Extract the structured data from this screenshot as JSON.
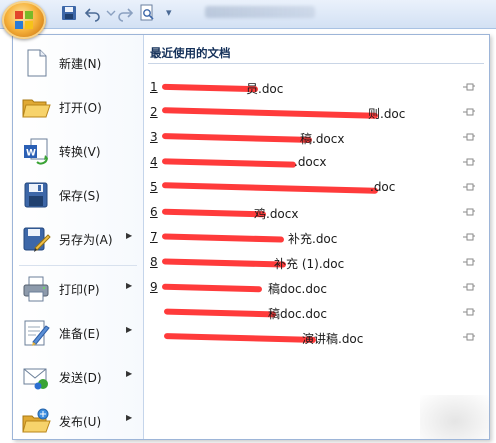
{
  "menu": {
    "items": [
      {
        "label": "新建(N)",
        "icon": "new-document-icon",
        "submenu": false
      },
      {
        "label": "打开(O)",
        "icon": "open-folder-icon",
        "submenu": false
      },
      {
        "label": "转换(V)",
        "icon": "convert-icon",
        "submenu": false
      },
      {
        "label": "保存(S)",
        "icon": "save-icon",
        "submenu": false
      },
      {
        "label": "另存为(A)",
        "icon": "save-as-icon",
        "submenu": true
      },
      {
        "label": "打印(P)",
        "icon": "print-icon",
        "submenu": true
      },
      {
        "label": "准备(E)",
        "icon": "prepare-icon",
        "submenu": true
      },
      {
        "label": "发送(D)",
        "icon": "send-icon",
        "submenu": true
      },
      {
        "label": "发布(U)",
        "icon": "publish-icon",
        "submenu": true
      }
    ]
  },
  "recent": {
    "header": "最近使用的文档",
    "documents": [
      {
        "num": "1",
        "visible_text": "员.doc"
      },
      {
        "num": "2",
        "visible_text": "则.doc"
      },
      {
        "num": "3",
        "visible_text": "稿.docx"
      },
      {
        "num": "4",
        "visible_text": ".docx"
      },
      {
        "num": "5",
        "visible_text": ".doc"
      },
      {
        "num": "6",
        "visible_text": "鸡.docx"
      },
      {
        "num": "7",
        "visible_text": "补充.doc"
      },
      {
        "num": "8",
        "visible_text": "补充 (1).doc"
      },
      {
        "num": "9",
        "visible_text": "稿doc.doc"
      },
      {
        "num": "",
        "visible_text": "稿doc.doc"
      },
      {
        "num": "",
        "visible_text": "演讲稿.doc"
      }
    ]
  },
  "colors": {
    "accent": "#15315a",
    "redaction": "#ff2a2a",
    "frame": "#9db5d8"
  }
}
